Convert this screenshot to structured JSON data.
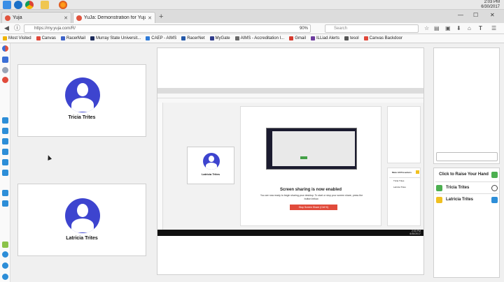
{
  "taskbar": {
    "time": "2:03 PM",
    "date": "6/30/2017",
    "icons": [
      "windows-icon",
      "explorer-icon",
      "chrome-icon",
      "folder-icon",
      "firefox-icon"
    ]
  },
  "browser": {
    "tabs": [
      {
        "label": "Yuja",
        "active": false
      },
      {
        "label": "YuJa: Demonstration for Yuja",
        "active": true
      }
    ],
    "url": "https://my.yuja.com/R/",
    "zoom": "90%",
    "search_placeholder": "Search",
    "bookmarks": [
      {
        "label": "Most Visited",
        "color": "#f0b400"
      },
      {
        "label": "Canvas",
        "color": "#e0473a"
      },
      {
        "label": "RacerMail",
        "color": "#3e63c9"
      },
      {
        "label": "Murray State Universit...",
        "color": "#1b2a5b"
      },
      {
        "label": "CAEP - AIMS",
        "color": "#2f7bd9"
      },
      {
        "label": "RacerNet",
        "color": "#2458a8"
      },
      {
        "label": "MyGate",
        "color": "#2f3c8c"
      },
      {
        "label": "AIMS - Accreditation I...",
        "color": "#6a6a6a"
      },
      {
        "label": "Gmail",
        "color": "#d63b2f"
      },
      {
        "label": "ILLiad Alerts",
        "color": "#6c3b9e"
      },
      {
        "label": "tesol",
        "color": "#555555"
      },
      {
        "label": "Canvas Backdoor",
        "color": "#e0473a"
      }
    ]
  },
  "participants": [
    {
      "name": "Tricia Trites"
    },
    {
      "name": "Latricia Trites"
    }
  ],
  "shared_screen": {
    "participant": "Latricia Trites",
    "heading": "Screen sharing is now enabled",
    "body": "You are now ready to begin sharing your desktop. To start or stop your screen share, press the button below.",
    "button": "Stop Screen Share (Ctrl+K)",
    "time": "2:03 PM",
    "date": "6/30/2017",
    "participant_list_title": "Mute All Presenters"
  },
  "raise_hand": {
    "title": "Click to Raise Your Hand",
    "participants": [
      {
        "name": "Tricia Trites",
        "badge_color": "#4caf50",
        "icon": "user-icon"
      },
      {
        "name": "Latricia Trites",
        "badge_color": "#f0c020",
        "icon": "screen-share-icon"
      }
    ]
  },
  "colors": {
    "avatar": "#3d44cf",
    "stop_button": "#e14b3b",
    "accent": "#4caf50"
  }
}
